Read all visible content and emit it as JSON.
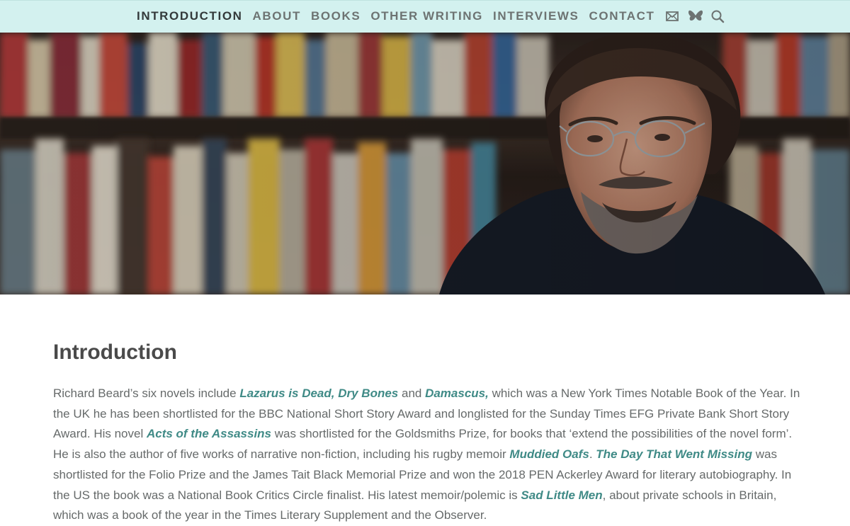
{
  "nav": {
    "items": [
      {
        "label": "INTRODUCTION",
        "active": true
      },
      {
        "label": "ABOUT",
        "active": false
      },
      {
        "label": "BOOKS",
        "active": false
      },
      {
        "label": "OTHER WRITING",
        "active": false
      },
      {
        "label": "INTERVIEWS",
        "active": false
      },
      {
        "label": "CONTACT",
        "active": false
      }
    ],
    "icons": [
      "mail-icon",
      "butterfly-icon",
      "search-icon"
    ]
  },
  "hero": {
    "image_subject": "author portrait in front of bookshelves"
  },
  "main": {
    "title": "Introduction",
    "paragraph": [
      {
        "t": "Richard Beard’s six novels include "
      },
      {
        "t": "Lazarus is Dead",
        "link": true
      },
      {
        "t": ", ",
        "link": true
      },
      {
        "t": "Dry Bones",
        "link": true
      },
      {
        "t": " and "
      },
      {
        "t": "Damascus,",
        "link": true
      },
      {
        "t": " which was a New York Times Notable Book of the Year. In the UK he has been shortlisted for the BBC National Short Story Award and longlisted for the Sunday Times EFG Private Bank Short Story Award. His novel "
      },
      {
        "t": "Acts of the Assassins",
        "link": true
      },
      {
        "t": " was shortlisted for the Goldsmiths Prize, for books that ‘extend the possibilities of the novel form’. He is also the author of five works of narrative non-fiction, including his rugby memoir "
      },
      {
        "t": "Muddied Oafs",
        "link": true
      },
      {
        "t": ". "
      },
      {
        "t": "The Day That Went Missing",
        "link": true
      },
      {
        "t": " was shortlisted for the Folio Prize and the James Tait Black Memorial Prize and won the 2018 PEN Ackerley Award for literary autobiography.  In the US the book was a National Book Critics Circle finalist. His latest memoir/polemic is "
      },
      {
        "t": "Sad Little Men",
        "link": true
      },
      {
        "t": ", about private schools in Britain, which was a book of the year in the Times Literary Supplement and the Observer."
      }
    ]
  },
  "colors": {
    "topbar_bg": "#d3f1ef",
    "nav_text": "#6d7372",
    "nav_active": "#33393a",
    "link": "#3f8a86",
    "body_text": "#666a6a",
    "title": "#4a4a4a"
  }
}
